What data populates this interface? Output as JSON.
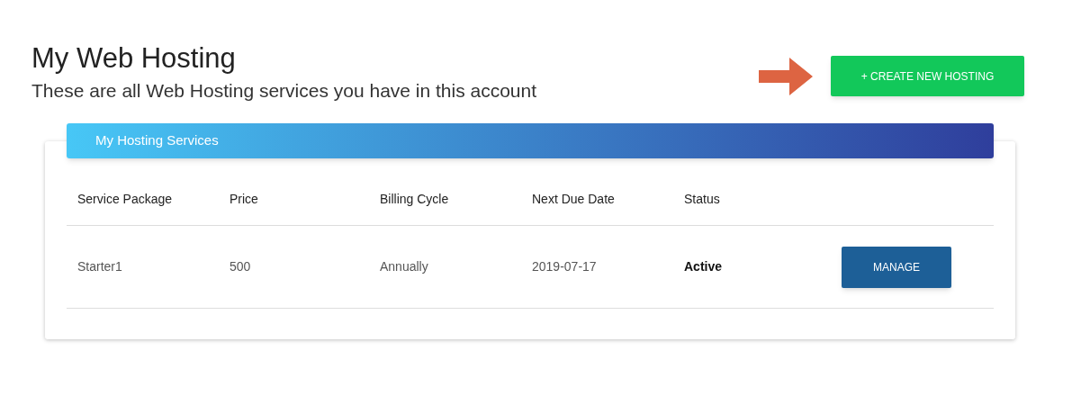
{
  "page": {
    "title": "My Web Hosting",
    "subtitle": "These are all Web Hosting services you have in this account"
  },
  "create_button": {
    "label": "+ CREATE NEW HOSTING"
  },
  "card": {
    "title": "My Hosting Services"
  },
  "table": {
    "columns": [
      "Service Package",
      "Price",
      "Billing Cycle",
      "Next Due Date",
      "Status"
    ],
    "rows": [
      {
        "cells": [
          "Starter1",
          "500",
          "Annually",
          "2019-07-17",
          "Active"
        ],
        "action": "MANAGE"
      }
    ]
  }
}
